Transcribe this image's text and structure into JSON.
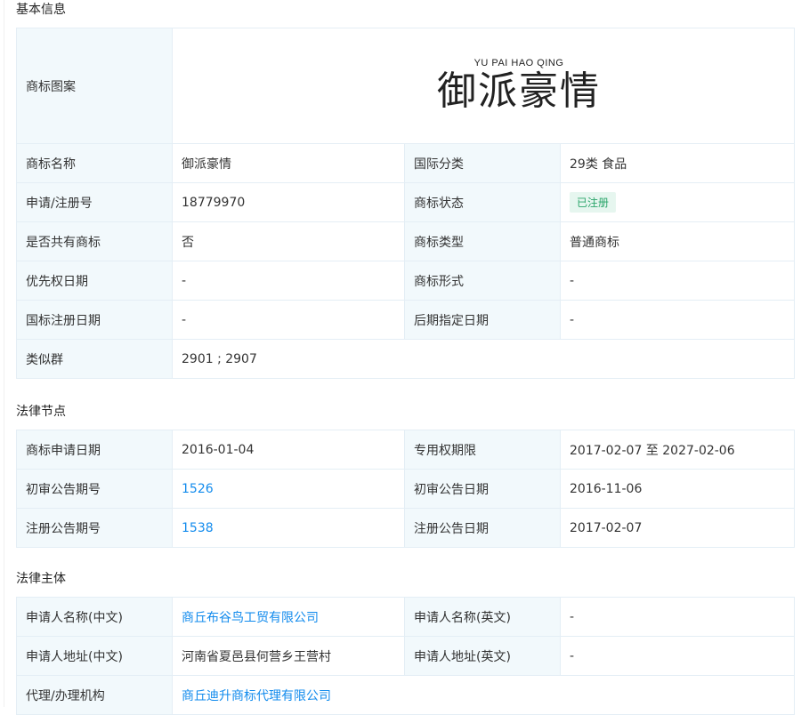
{
  "basic": {
    "title": "基本信息",
    "logo_label": "商标图案",
    "logo_pinyin": "YU PAI HAO QING",
    "logo_text": "御派豪情",
    "rows": [
      [
        "商标名称",
        "御派豪情",
        "国际分类",
        "29类 食品"
      ],
      [
        "申请/注册号",
        "18779970",
        "商标状态",
        "已注册"
      ],
      [
        "是否共有商标",
        "否",
        "商标类型",
        "普通商标"
      ],
      [
        "优先权日期",
        "-",
        "商标形式",
        "-"
      ],
      [
        "国标注册日期",
        "-",
        "后期指定日期",
        "-"
      ]
    ],
    "similar_label": "类似群",
    "similar_value": "2901 ; 2907"
  },
  "legal": {
    "title": "法律节点",
    "rows": [
      [
        "商标申请日期",
        "2016-01-04",
        "专用权期限",
        "2017-02-07 至 2027-02-06"
      ],
      [
        "初审公告期号",
        "1526",
        "初审公告日期",
        "2016-11-06"
      ],
      [
        "注册公告期号",
        "1538",
        "注册公告日期",
        "2017-02-07"
      ]
    ]
  },
  "subject": {
    "title": "法律主体",
    "rows": [
      [
        "申请人名称(中文)",
        "商丘布谷鸟工贸有限公司",
        "申请人名称(英文)",
        "-"
      ],
      [
        "申请人地址(中文)",
        "河南省夏邑县何营乡王营村",
        "申请人地址(英文)",
        "-"
      ]
    ],
    "agent_label": "代理/办理机构",
    "agent_value": "商丘迪升商标代理有限公司"
  },
  "colors": {
    "link": "#128bed",
    "label_bg": "#f2f9fc",
    "badge_bg": "#e6f6ef",
    "badge_text": "#2aa56a"
  }
}
